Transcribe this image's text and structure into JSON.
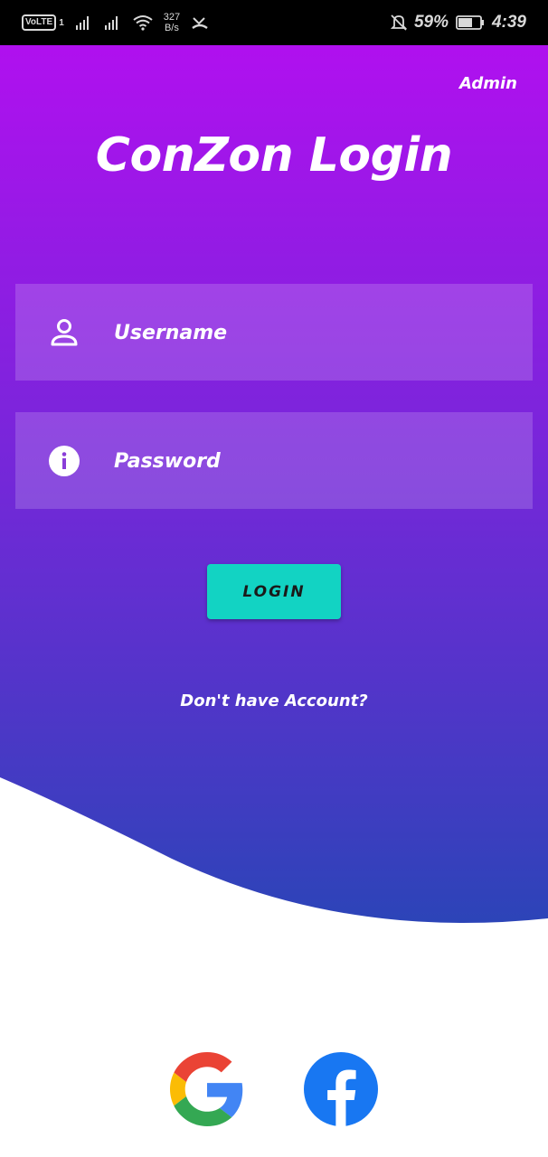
{
  "status_bar": {
    "volte": "VoLTE",
    "sim": "1",
    "speed_value": "327",
    "speed_unit": "B/s",
    "battery": "59%",
    "time": "4:39"
  },
  "admin_label": "Admin",
  "title": "ConZon Login",
  "username": {
    "placeholder": "Username",
    "value": ""
  },
  "password": {
    "placeholder": "Password",
    "value": ""
  },
  "login_label": "LOGIN",
  "signup_link": "Don't have Account?",
  "colors": {
    "gradient_top": "#b010ef",
    "gradient_bottom": "#2c44b8",
    "button": "#12d3c3"
  },
  "social": [
    "google-logo",
    "facebook-logo"
  ]
}
